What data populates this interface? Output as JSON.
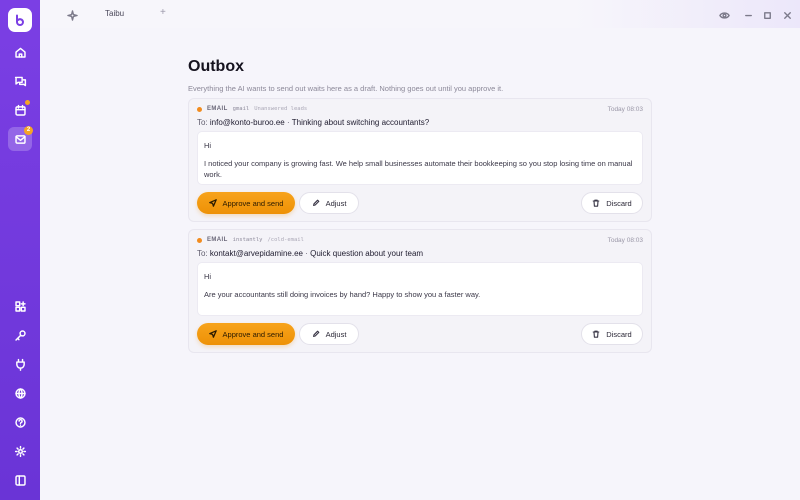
{
  "titlebar": {
    "tab_name": "Taibu",
    "add_tab": "+"
  },
  "sidebar": {
    "items": [
      {
        "icon": "home-icon"
      },
      {
        "icon": "chat-icon"
      },
      {
        "icon": "calendar-icon",
        "dot": true
      },
      {
        "icon": "inbox-icon",
        "badge": "2",
        "active": true
      },
      {
        "icon": "apps-icon"
      },
      {
        "icon": "key-icon"
      },
      {
        "icon": "plug-icon"
      },
      {
        "icon": "globe-icon"
      },
      {
        "icon": "help-icon"
      },
      {
        "icon": "gear-icon"
      },
      {
        "icon": "sidebar-toggle-icon"
      }
    ]
  },
  "page": {
    "title": "Outbox",
    "subtitle": "Everything the AI wants to send out waits here as a draft. Nothing goes out until you approve it."
  },
  "drafts": [
    {
      "kind": "EMAIL",
      "source": "gmail",
      "list": "Unanswered leads",
      "time": "Today 08:03",
      "to_label": "To:",
      "to": "info@konto-buroo.ee",
      "separator": "·",
      "subject": "Thinking about switching accountants?",
      "greeting": "Hi",
      "body": "I noticed your company is growing fast. We help small businesses automate their bookkeeping so you stop losing time on manual work.",
      "approve_label": "Approve and send",
      "adjust_label": "Adjust",
      "discard_label": "Discard"
    },
    {
      "kind": "EMAIL",
      "source": "instantly",
      "list": "/cold-email",
      "time": "Today 08:03",
      "to_label": "To:",
      "to": "kontakt@arvepidamine.ee",
      "separator": "·",
      "subject": "Quick question about your team",
      "greeting": "Hi",
      "body": "Are your accountants still doing invoices by hand? Happy to show you a faster way.",
      "approve_label": "Approve and send",
      "adjust_label": "Adjust",
      "discard_label": "Discard"
    }
  ],
  "colors": {
    "sidebar": "#7b3fe4",
    "accent": "#f7a31c",
    "status_dot": "#f28c1e"
  }
}
